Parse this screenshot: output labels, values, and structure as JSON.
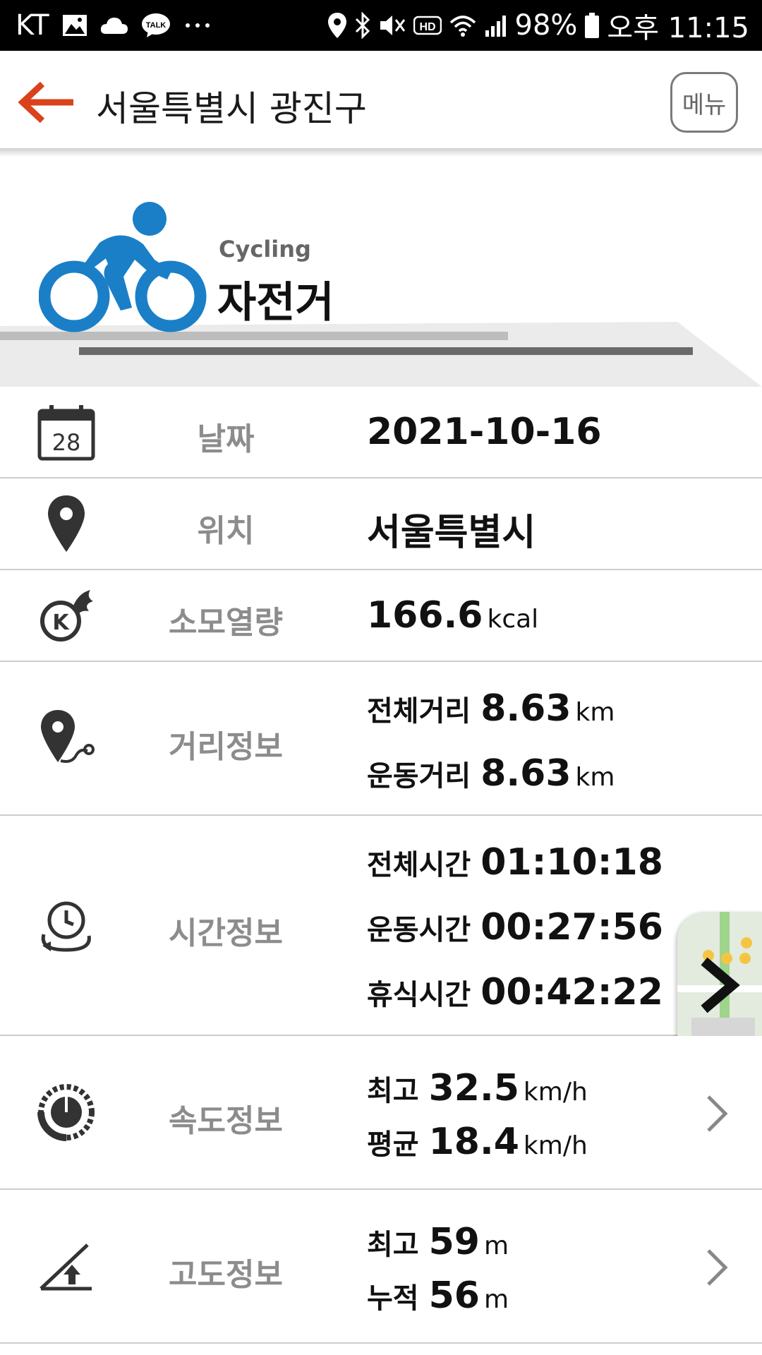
{
  "status_bar": {
    "carrier": "KT",
    "battery": "98%",
    "time": "오후 11:15"
  },
  "header": {
    "title": "서울특별시 광진구",
    "menu_label": "메뉴"
  },
  "activity": {
    "name_en": "Cycling",
    "name_ko": "자전거",
    "icon_color": "#1a7fc7"
  },
  "date": {
    "label": "날짜",
    "value": "2021-10-16",
    "calendar_day": "28"
  },
  "location": {
    "label": "위치",
    "value": "서울특별시"
  },
  "calories": {
    "label": "소모열량",
    "value": "166.6",
    "unit": "kcal"
  },
  "distance": {
    "label": "거리정보",
    "total_label": "전체거리",
    "total_value": "8.63",
    "total_unit": "km",
    "moving_label": "운동거리",
    "moving_value": "8.63",
    "moving_unit": "km"
  },
  "time": {
    "label": "시간정보",
    "total_label": "전체시간",
    "total_value": "01:10:18",
    "moving_label": "운동시간",
    "moving_value": "00:27:56",
    "rest_label": "휴식시간",
    "rest_value": "00:42:22"
  },
  "speed": {
    "label": "속도정보",
    "max_label": "최고",
    "max_value": "32.5",
    "max_unit": "km/h",
    "avg_label": "평균",
    "avg_value": "18.4",
    "avg_unit": "km/h"
  },
  "altitude": {
    "label": "고도정보",
    "max_label": "최고",
    "max_value": "59",
    "max_unit": "m",
    "cum_label": "누적",
    "cum_value": "56",
    "cum_unit": "m"
  },
  "colors": {
    "accent": "#d9421b",
    "icon_blue": "#1a7fc7",
    "label_gray": "#8c8c8c"
  },
  "icons": {
    "back": "arrow-left-icon",
    "map": "map-thumbnail"
  }
}
